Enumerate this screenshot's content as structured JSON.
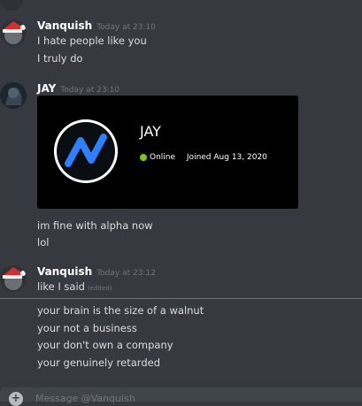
{
  "messages": [
    {
      "username": "Vanquish",
      "timestamp": "Today at 23:10",
      "lines": [
        "I hate people like you",
        "I truly do"
      ]
    },
    {
      "username": "JAY",
      "timestamp": "Today at 23:10",
      "profile_card": {
        "name": "JAY",
        "status": "Online",
        "joined": "Joined Aug 13, 2020"
      },
      "lines": [
        "im fine with alpha now",
        "lol"
      ]
    },
    {
      "username": "Vanquish",
      "timestamp": "Today at 23:12",
      "lines": [
        "like I said",
        "your brain is the size of a walnut",
        "your not a business",
        "your don't own a company",
        "your genuinely retarded"
      ],
      "edited_label": "(edited)"
    }
  ],
  "composer": {
    "placeholder": "Message @Vanquish"
  },
  "colors": {
    "background": "#36393f",
    "card_background": "#000000",
    "online": "#7fc51c",
    "new_messages_divider": "#d24b51"
  },
  "icons": {
    "add": "plus-circle-icon",
    "card_logo": "n-logo-icon"
  }
}
